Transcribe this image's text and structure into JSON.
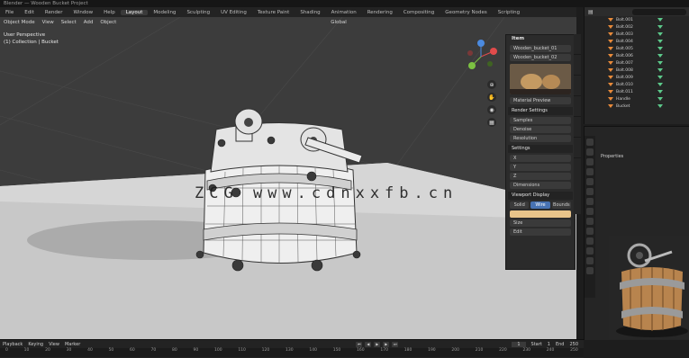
{
  "window": {
    "title": "Blender — Wooden Bucket Project"
  },
  "menu": {
    "items": [
      "File",
      "Edit",
      "Render",
      "Window",
      "Help",
      "Layout",
      "Modeling",
      "Sculpting",
      "UV Editing",
      "Texture Paint",
      "Shading",
      "Animation",
      "Rendering",
      "Compositing",
      "Geometry Nodes",
      "Scripting"
    ],
    "active_index": 5
  },
  "viewport_header": {
    "mode": "Object Mode",
    "view": "View",
    "select": "Select",
    "add": "Add",
    "object": "Object",
    "orientation": "Global"
  },
  "viewport_info": {
    "line1": "User Perspective",
    "line2": "(1) Collection | Bucket"
  },
  "gizmo": {
    "x": "X",
    "y": "Y",
    "z": "Z",
    "x_color": "#e14b4b",
    "y_color": "#7cc242",
    "z_color": "#4b8be1"
  },
  "npanel": {
    "header": "Item",
    "rows": [
      "Wooden_bucket_01",
      "Wooden_bucket_02",
      "Material Preview"
    ],
    "section_render": "Render Settings",
    "render_rows": [
      "Samples",
      "Denoise",
      "Resolution"
    ],
    "section_settings": "Settings",
    "setting_rows": [
      "X",
      "Y",
      "Z",
      "Dimensions"
    ],
    "section_display": "Viewport Display",
    "display_tabs": [
      "Solid",
      "Wire",
      "Bounds"
    ],
    "display_selected": 1,
    "color_label": "Color",
    "size_label": "Size",
    "footer": "Edit",
    "swatch_color": "#e8c48a"
  },
  "outliner": {
    "rows": [
      "Bolt.001",
      "Bolt.002",
      "Bolt.003",
      "Bolt.004",
      "Bolt.005",
      "Bolt.006",
      "Bolt.007",
      "Bolt.008",
      "Bolt.009",
      "Bolt.010",
      "Bolt.011",
      "Handle",
      "Bucket"
    ]
  },
  "properties": {
    "title": "Properties"
  },
  "timeline": {
    "menus": [
      "Playback",
      "Keying",
      "View",
      "Marker"
    ],
    "start_label": "Start",
    "start": "1",
    "end_label": "End",
    "end": "250",
    "current": "1",
    "frame_ticks": [
      "0",
      "10",
      "20",
      "30",
      "40",
      "50",
      "60",
      "70",
      "80",
      "90",
      "100",
      "110",
      "120",
      "130",
      "140",
      "150",
      "160",
      "170",
      "180",
      "190",
      "200",
      "210",
      "220",
      "230",
      "240",
      "250"
    ]
  },
  "watermark": "ZCG www.cdnxxfb.cn"
}
